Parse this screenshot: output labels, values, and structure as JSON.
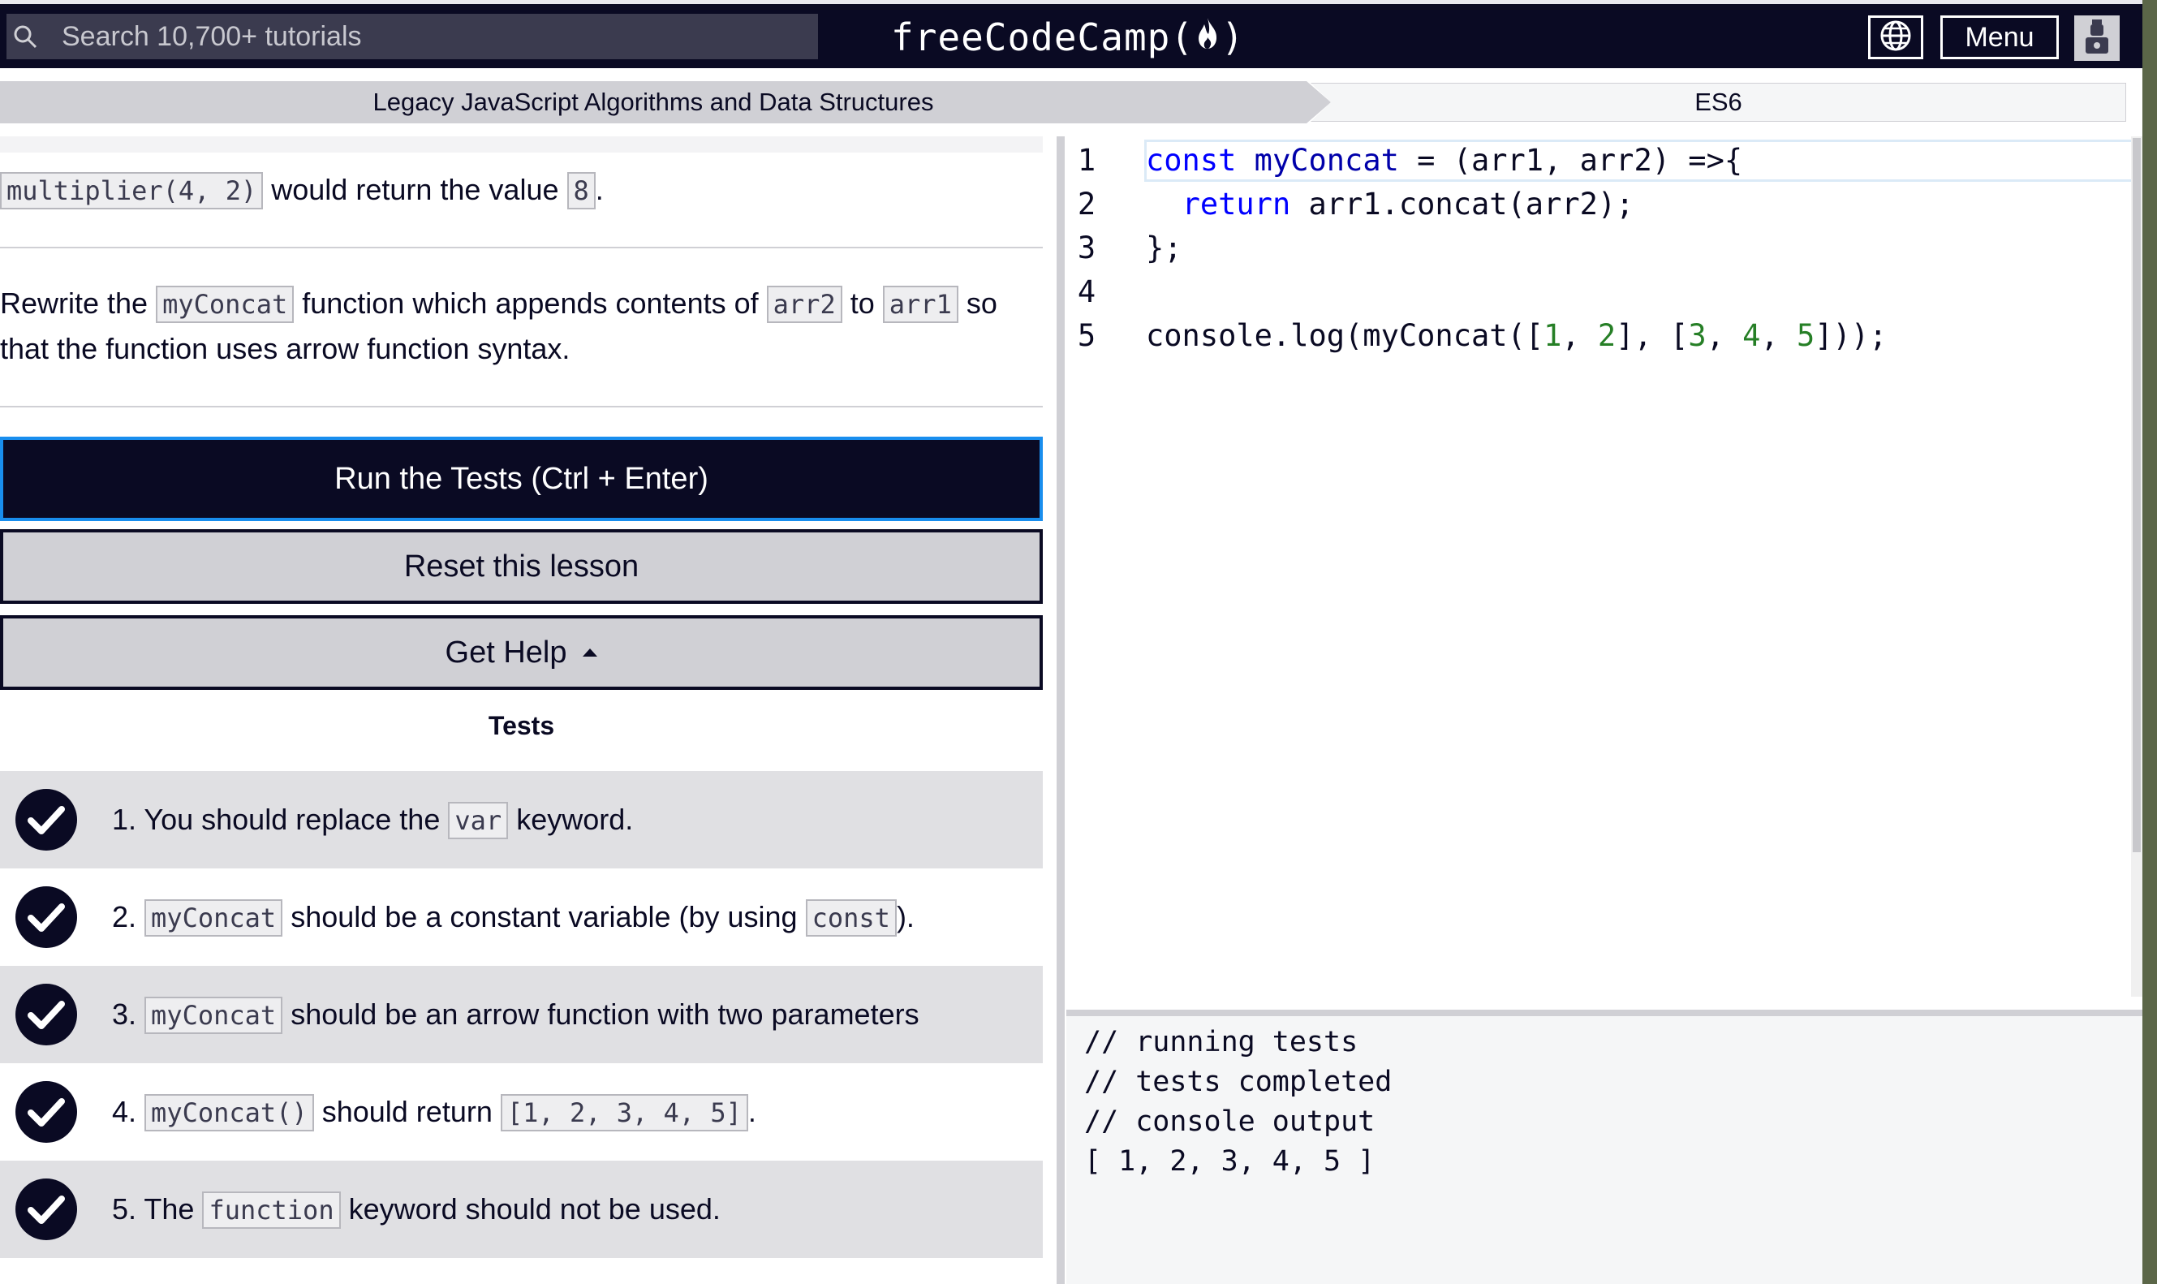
{
  "navbar": {
    "search_placeholder": "Search 10,700+ tutorials",
    "logo_text_before": "freeCodeCamp(",
    "logo_text_after": ")",
    "menu_label": "Menu",
    "icons": {
      "search": "search-icon",
      "language": "globe-icon",
      "logo": "flame-icon",
      "avatar": "avatar-icon"
    }
  },
  "breadcrumb": {
    "superblock": "Legacy JavaScript Algorithms and Data Structures",
    "block": "ES6"
  },
  "instructions": {
    "example": {
      "code": "multiplier(4, 2)",
      "text": "would return the value",
      "value": "8",
      "end": "."
    },
    "task": {
      "pre": "Rewrite the",
      "fn": "myConcat",
      "mid": "function which appends contents of",
      "arr_a": "arr2",
      "to": "to",
      "arr_b": "arr1",
      "so": "so",
      "line2": "that the function uses arrow function syntax."
    }
  },
  "buttons": {
    "run": "Run the Tests (Ctrl + Enter)",
    "reset": "Reset this lesson",
    "help": "Get Help"
  },
  "tests": {
    "heading": "Tests",
    "items": [
      {
        "num": "1.",
        "pre": "You should replace the",
        "code": "var",
        "post": "keyword."
      },
      {
        "num": "2.",
        "code": "myConcat",
        "mid": "should be a constant variable (by using",
        "code2": "const",
        "post": ")."
      },
      {
        "num": "3.",
        "code": "myConcat",
        "post": "should be an arrow function with two parameters"
      },
      {
        "num": "4.",
        "code": "myConcat()",
        "mid": "should return",
        "code2": "[1, 2, 3, 4, 5]",
        "post": "."
      },
      {
        "num": "5.",
        "pre": "The",
        "code": "function",
        "post": "keyword should not be used."
      }
    ]
  },
  "editor": {
    "line_numbers": [
      "1",
      "2",
      "3",
      "4",
      "5"
    ],
    "line1": {
      "kw": "const",
      "name": " myConcat",
      "rest": " = (arr1, arr2) =>{"
    },
    "line2": {
      "indent": "  ",
      "kw": "return",
      "rest": " arr1.concat(arr2);"
    },
    "line3": "};",
    "line5": {
      "a": "console.log(myConcat([",
      "n1": "1",
      "c1": ", ",
      "n2": "2",
      "c2": "], [",
      "n3": "3",
      "c3": ", ",
      "n4": "4",
      "c4": ", ",
      "n5": "5",
      "end": "]));"
    }
  },
  "console": {
    "lines": [
      "// running tests",
      "// tests completed",
      "// console output",
      "[ 1, 2, 3, 4, 5 ]"
    ]
  },
  "colors": {
    "nav_bg": "#0a0a23",
    "accent_blue": "#198eee",
    "button_gray": "#d0d0d5",
    "row_shade": "#e0e0e3"
  }
}
